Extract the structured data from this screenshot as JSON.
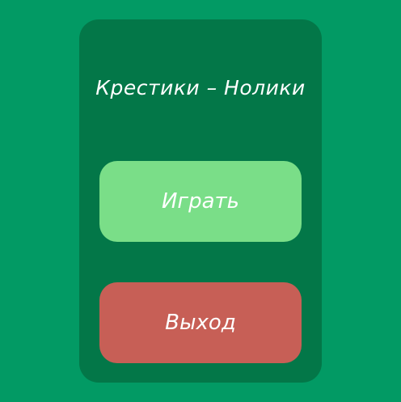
{
  "colors": {
    "background": "#029a64",
    "panel": "#037748",
    "play_button": "#7ade88",
    "exit_button": "#c75f56",
    "text": "#ffffff"
  },
  "menu": {
    "title": "Крестики – Нолики",
    "play_label": "Играть",
    "exit_label": "Выход"
  }
}
